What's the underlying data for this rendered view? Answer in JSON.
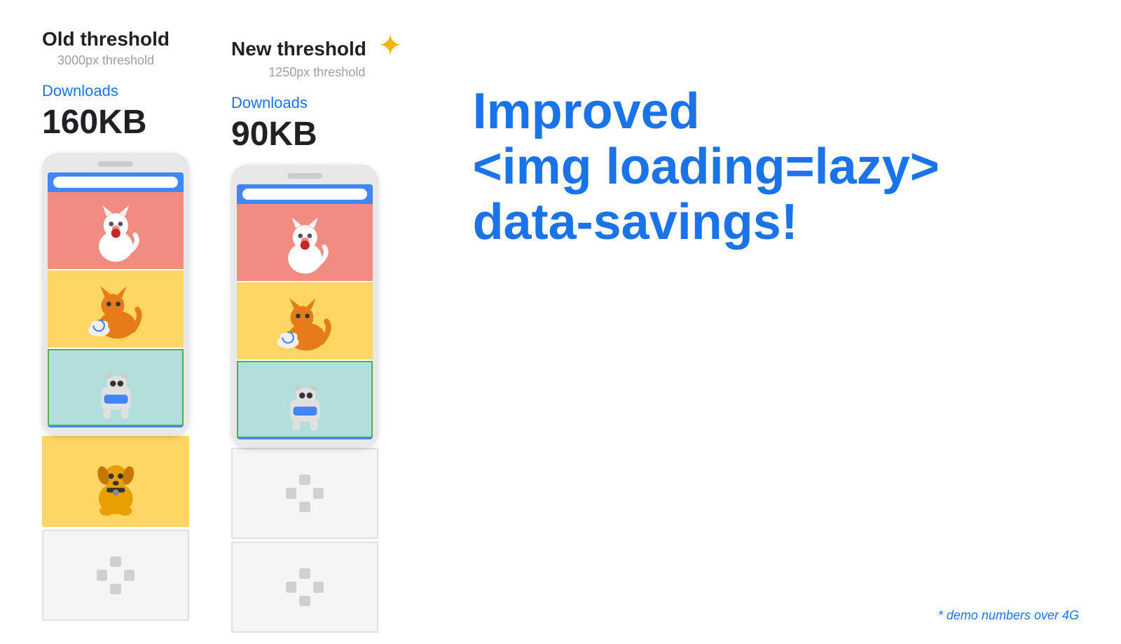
{
  "left_column": {
    "threshold_title": "Old threshold",
    "threshold_subtitle": "3000px threshold",
    "downloads_label": "Downloads",
    "downloads_size": "160KB"
  },
  "right_column": {
    "threshold_title": "New threshold",
    "threshold_subtitle": "1250px threshold",
    "downloads_label": "Downloads",
    "downloads_size": "90KB"
  },
  "hero_text": {
    "line1": "Improved",
    "line2": "<img loading=lazy>",
    "line3": "data-savings!"
  },
  "demo_note": "* demo numbers over 4G",
  "sparkle": "✦"
}
